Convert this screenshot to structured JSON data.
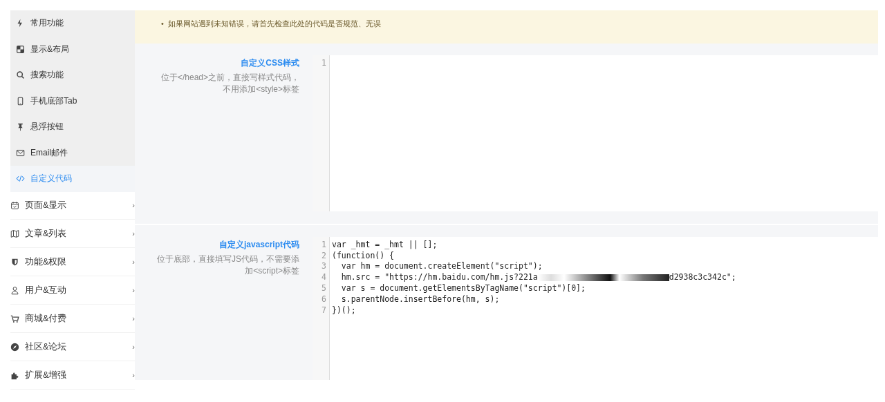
{
  "sidebar": {
    "sub_items": [
      {
        "label": "常用功能",
        "selected": false
      },
      {
        "label": "显示&布局",
        "selected": false
      },
      {
        "label": "搜索功能",
        "selected": false
      },
      {
        "label": "手机底部Tab",
        "selected": false
      },
      {
        "label": "悬浮按钮",
        "selected": false
      },
      {
        "label": "Email邮件",
        "selected": false
      },
      {
        "label": "自定义代码",
        "selected": true
      }
    ],
    "groups": [
      {
        "label": "页面&显示",
        "chevron": "›",
        "expanded": false
      },
      {
        "label": "文章&列表",
        "chevron": "›",
        "expanded": false
      },
      {
        "label": "功能&权限",
        "chevron": "›",
        "expanded": false
      },
      {
        "label": "用户&互动",
        "chevron": "›",
        "expanded": false
      },
      {
        "label": "商城&付费",
        "chevron": "›",
        "expanded": false
      },
      {
        "label": "社区&论坛",
        "chevron": "›",
        "expanded": false
      },
      {
        "label": "扩展&增强",
        "chevron": "›",
        "expanded": false
      }
    ]
  },
  "notice": {
    "items": [
      {
        "bullet": "•",
        "text": "如果网站遇到未知错误，请首先检查此处的代码是否规范、无误"
      }
    ]
  },
  "sections": [
    {
      "title": "自定义CSS样式",
      "description": "位于</head>之前，直接写样式代码，不用添加<style>标签",
      "editor": {
        "lines": [
          {
            "number": "1"
          }
        ]
      }
    },
    {
      "title": "自定义javascript代码",
      "description": "位于底部，直接填写JS代码，不需要添加<script>标签",
      "editor": {
        "lines": [
          {
            "number": "1",
            "text": "var _hmt = _hmt || [];"
          },
          {
            "number": "2",
            "text": "(function() {"
          },
          {
            "number": "3",
            "text": "  var hm = document.createElement(\"script\");"
          },
          {
            "number": "4",
            "text": "  hm.src = \"https://hm.baidu.com/hm.js?221a",
            "redacted": true,
            "after": "d2938c3c342c\";"
          },
          {
            "number": "5",
            "text": "  var s = document.getElementsByTagName(\"script\")[0];"
          },
          {
            "number": "6",
            "text": "  s.parentNode.insertBefore(hm, s);"
          },
          {
            "number": "7",
            "text": "})();"
          }
        ]
      }
    }
  ]
}
